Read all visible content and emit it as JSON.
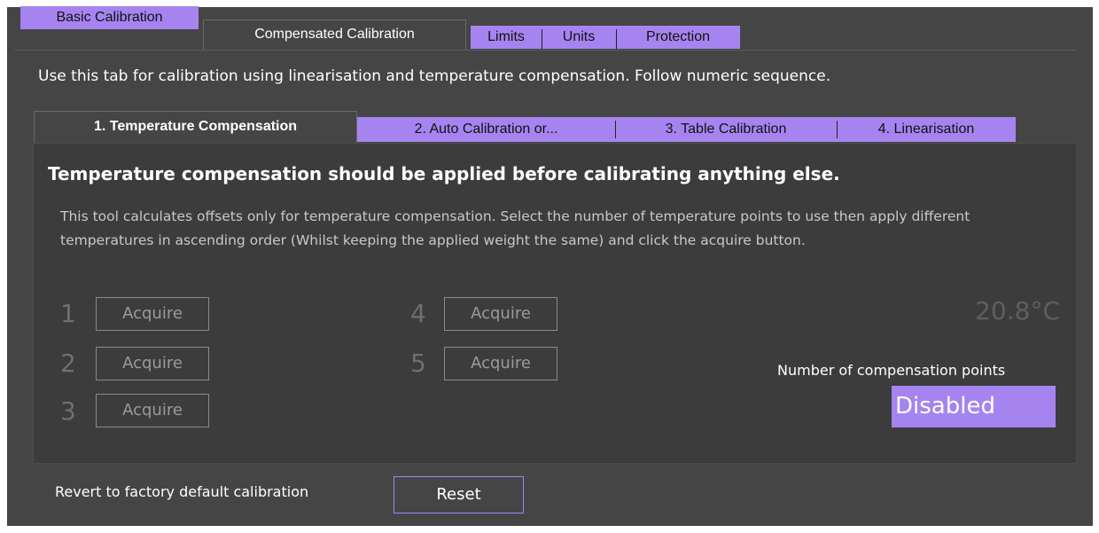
{
  "top_tabs": [
    {
      "label": "Basic Calibration"
    },
    {
      "label": "Compensated Calibration"
    },
    {
      "label": "Limits"
    },
    {
      "label": "Units"
    },
    {
      "label": "Protection"
    }
  ],
  "description": "Use this tab for calibration using linearisation and temperature compensation. Follow numeric sequence.",
  "sub_tabs": [
    {
      "label": "1. Temperature Compensation"
    },
    {
      "label": "2. Auto Calibration or..."
    },
    {
      "label": "3. Table Calibration"
    },
    {
      "label": "4. Linearisation"
    }
  ],
  "heading": "Temperature compensation should be applied before calibrating anything else.",
  "info": "This tool calculates offsets only for temperature compensation. Select the number of temperature points to use  then apply different temperatures in ascending order (Whilst keeping the applied weight the same) and click the acquire button.",
  "points": [
    {
      "number": "1",
      "button": "Acquire"
    },
    {
      "number": "2",
      "button": "Acquire"
    },
    {
      "number": "3",
      "button": "Acquire"
    },
    {
      "number": "4",
      "button": "Acquire"
    },
    {
      "number": "5",
      "button": "Acquire"
    }
  ],
  "temperature": "20.8°C",
  "compensation_points": {
    "label": "Number of compensation points",
    "value": "Disabled"
  },
  "revert": {
    "label": "Revert to factory default calibration",
    "button": "Reset"
  },
  "colors": {
    "accent": "#a684f0",
    "background": "#454545",
    "panel": "#3c3c3c"
  }
}
